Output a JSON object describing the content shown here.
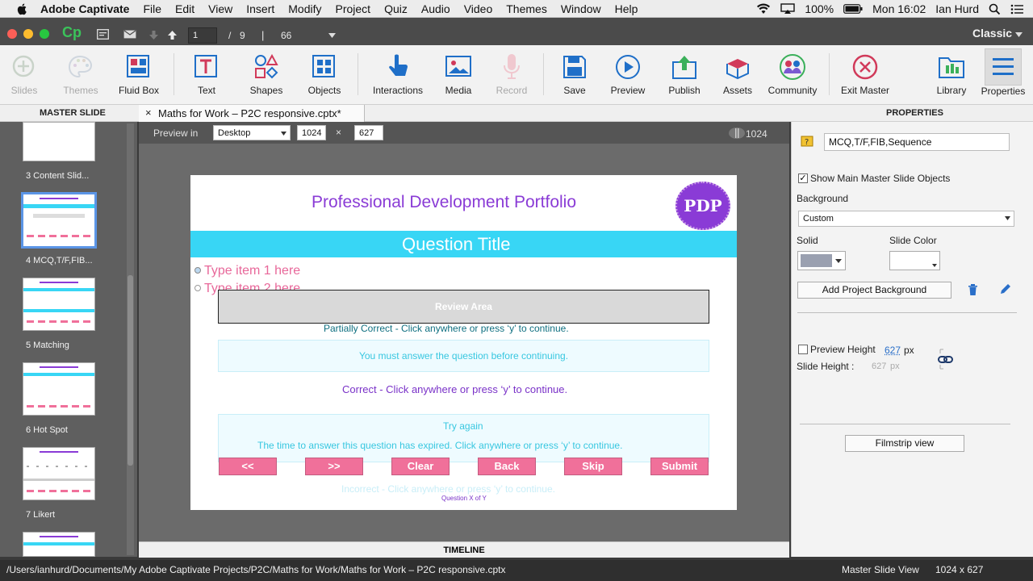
{
  "menubar": {
    "app_name": "Adobe Captivate",
    "items": [
      "File",
      "Edit",
      "View",
      "Insert",
      "Modify",
      "Project",
      "Quiz",
      "Audio",
      "Video",
      "Themes",
      "Window",
      "Help"
    ],
    "battery": "100%",
    "clock": "Mon 16:02",
    "user": "Ian Hurd"
  },
  "titlebar": {
    "logo": "Cp",
    "current_slide": "1",
    "slide_separator": "/",
    "total_slides": "9",
    "divider": "|",
    "zoom": "66",
    "workspace": "Classic"
  },
  "toolbar": {
    "slides": "Slides",
    "themes": "Themes",
    "fluid_box": "Fluid Box",
    "text": "Text",
    "shapes": "Shapes",
    "objects": "Objects",
    "interactions": "Interactions",
    "media": "Media",
    "record": "Record",
    "save": "Save",
    "preview": "Preview",
    "publish": "Publish",
    "assets": "Assets",
    "community": "Community",
    "exit_master": "Exit Master",
    "library": "Library",
    "properties": "Properties"
  },
  "panels": {
    "left_title": "MASTER SLIDE",
    "doc_tab": "Maths for Work – P2C responsive.cptx*",
    "doc_tab_close": "×",
    "right_title": "PROPERTIES",
    "timeline": "TIMELINE"
  },
  "filmstrip": {
    "items": [
      {
        "label": "3 Content Slid..."
      },
      {
        "label": "4 MCQ,T/F,FIB..."
      },
      {
        "label": "5 Matching"
      },
      {
        "label": "6 Hot Spot"
      },
      {
        "label": "7 Likert"
      }
    ]
  },
  "previewbar": {
    "label": "Preview in",
    "device": "Desktop",
    "width": "1024",
    "times": "×",
    "height": "627",
    "breakpoint": "1024"
  },
  "slide": {
    "header": "Professional Development Portfolio",
    "logo_text": "PDP",
    "question_title": "Question Title",
    "item1": "Type item 1 here",
    "item2": "Type item 2 here",
    "review_area": "Review Area",
    "partially_correct": "Partially Correct - Click anywhere or press ‘y’ to continue.",
    "must_answer": "You must answer the question before continuing.",
    "correct": "Correct - Click anywhere or press ‘y’ to continue.",
    "try_again": "Try again",
    "time_expired": "The time to answer this question has expired. Click anywhere or press ‘y’ to continue.",
    "incorrect": "Incorrect - Click anywhere or press ‘y’ to continue.",
    "progress": "Question X of Y",
    "buttons": [
      "<<",
      ">>",
      "Clear",
      "Back",
      "Skip",
      "Submit"
    ]
  },
  "properties": {
    "name": "MCQ,T/F,FIB,Sequence",
    "show_master": "Show Main Master Slide Objects",
    "background_label": "Background",
    "background_value": "Custom",
    "solid_label": "Solid",
    "slide_color_label": "Slide Color",
    "add_bg_button": "Add Project Background",
    "preview_height_label": "Preview Height",
    "preview_height_value": "627",
    "px": "px",
    "slide_height_label": "Slide Height :",
    "slide_height_value": "627",
    "filmstrip_view": "Filmstrip view"
  },
  "statusbar": {
    "path": "/Users/ianhurd/Documents/My Adobe Captivate Projects/P2C/Maths for Work/Maths for Work – P2C responsive.cptx",
    "view": "Master Slide View",
    "size": "1024 x 627"
  },
  "colors": {
    "accent_cyan": "#38d6f5",
    "title_purple": "#8a3bd6",
    "button_pink": "#f0709a",
    "dark_chrome": "#4b4b4b"
  }
}
